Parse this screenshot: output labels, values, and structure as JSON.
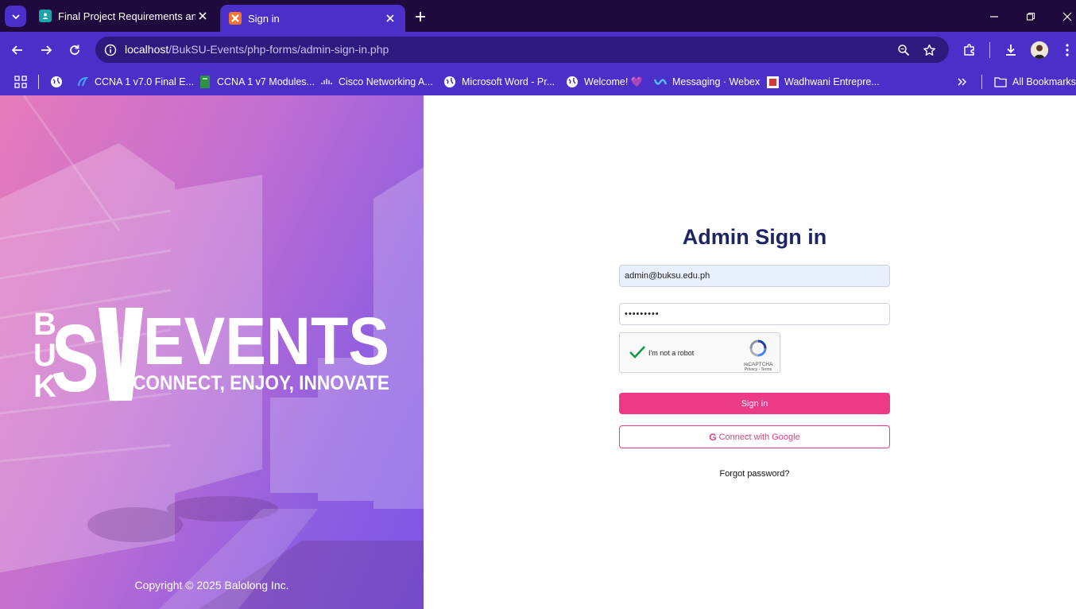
{
  "browser": {
    "tabs": [
      {
        "title": "Final Project Requirements and",
        "favicon": "classroom-icon",
        "active": false
      },
      {
        "title": "Sign in",
        "favicon": "xampp-icon",
        "active": true
      }
    ],
    "url_host": "localhost",
    "url_path": "/BukSU-Events/php-forms/admin-sign-in.php",
    "bookmarks": [
      {
        "label": "",
        "icon": "globe-icon"
      },
      {
        "label": "CCNA 1 v7.0 Final E...",
        "icon": "itexam-icon"
      },
      {
        "label": "CCNA 1 v7 Modules...",
        "icon": "bookmark-green-icon"
      },
      {
        "label": "Cisco Networking A...",
        "icon": "cisco-icon"
      },
      {
        "label": "Microsoft Word - Pr...",
        "icon": "globe-icon"
      },
      {
        "label": "Welcome! 💜",
        "icon": "globe-icon"
      },
      {
        "label": "Messaging · Webex",
        "icon": "webex-icon"
      },
      {
        "label": "Wadhwani Entrepre...",
        "icon": "wadhwani-icon"
      }
    ],
    "all_bookmarks_label": "All Bookmarks"
  },
  "hero": {
    "logo_text": "BUKSU EVENTS",
    "tagline": "CONNECT, ENJOY, INNOVATE",
    "copyright": "Copyright © 2025 Balolong Inc."
  },
  "form": {
    "title": "Admin Sign in",
    "email_value": "admin@buksu.edu.ph",
    "password_value": "•••••••••",
    "recaptcha_label": "I'm not a robot",
    "recaptcha_brand": "reCAPTCHA",
    "recaptcha_links": "Privacy - Terms",
    "signin_label": "Sign in",
    "google_label": "Connect with Google",
    "forgot_label": "Forgot password?"
  },
  "colors": {
    "accent": "#ec3a86",
    "browser_bar": "#4b2fc9",
    "title_text": "#1f2562"
  }
}
